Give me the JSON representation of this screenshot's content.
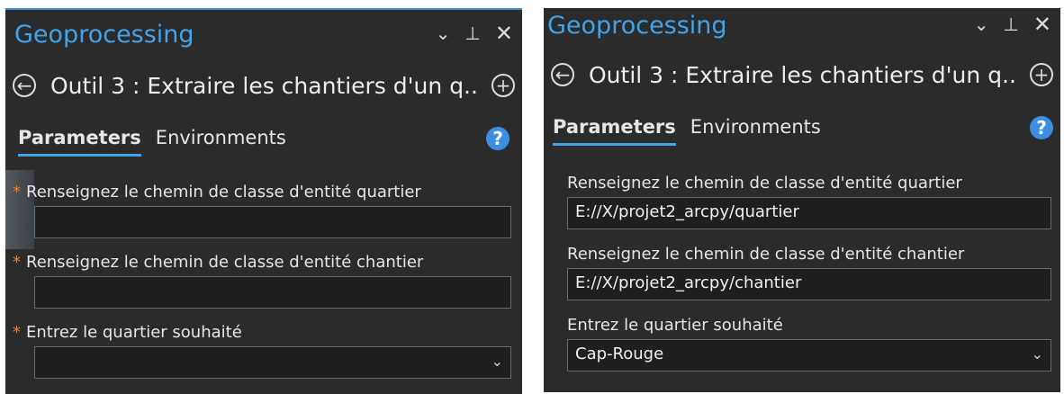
{
  "left": {
    "title": "Geoprocessing",
    "tool_name": "Outil 3 : Extraire les chantiers d'un q...",
    "tabs": [
      "Parameters",
      "Environments"
    ],
    "required_marker": "*",
    "params": [
      {
        "label": "Renseignez le chemin de classe d'entité quartier",
        "value": ""
      },
      {
        "label": "Renseignez le chemin de classe d'entité chantier",
        "value": ""
      },
      {
        "label": "Entrez le quartier souhaité",
        "value": ""
      }
    ]
  },
  "right": {
    "title": "Geoprocessing",
    "tool_name": "Outil 3 : Extraire les chantiers d'un q...",
    "tabs": [
      "Parameters",
      "Environments"
    ],
    "params": [
      {
        "label": "Renseignez le chemin de classe d'entité quartier",
        "value": "E://X/projet2_arcpy/quartier"
      },
      {
        "label": "Renseignez le chemin de classe d'entité chantier",
        "value": "E://X/projet2_arcpy/chantier"
      },
      {
        "label": "Entrez le quartier souhaité",
        "value": "Cap-Rouge"
      }
    ]
  },
  "icons": {
    "dropdown": "chevron-down-icon",
    "pin": "pin-icon",
    "close": "close-icon",
    "back": "back-arrow-icon",
    "add": "add-icon",
    "help": "help-icon"
  },
  "colors": {
    "accent": "#41a3ea",
    "background": "#2b2b2b",
    "required": "#e8812c"
  }
}
